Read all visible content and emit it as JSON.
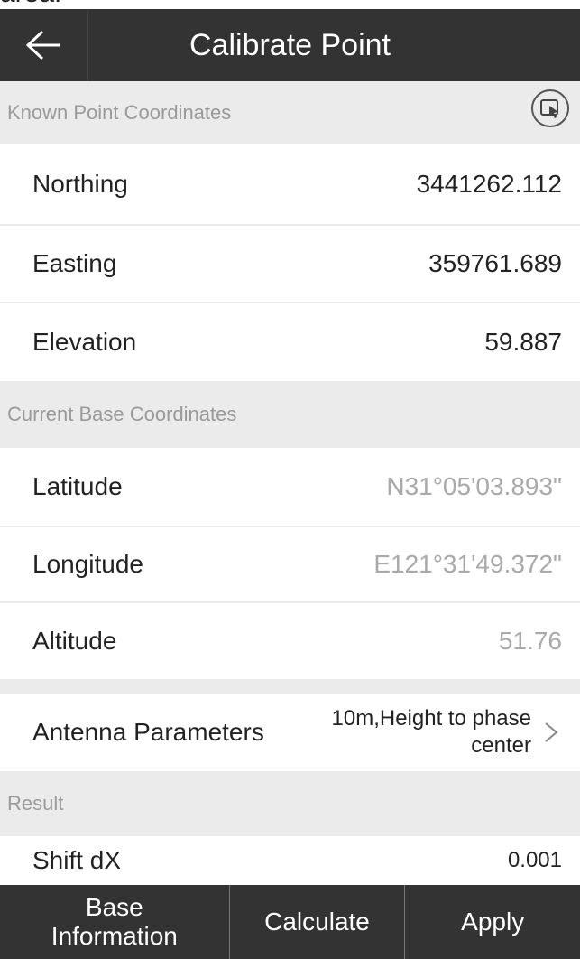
{
  "top_strip_text": "area.",
  "header": {
    "title": "Calibrate Point"
  },
  "known_section": {
    "title": "Known Point Coordinates"
  },
  "known_rows": [
    {
      "label": "Northing",
      "value": "3441262.112"
    },
    {
      "label": "Easting",
      "value": "359761.689"
    },
    {
      "label": "Elevation",
      "value": "59.887"
    }
  ],
  "base_section": {
    "title": "Current Base Coordinates"
  },
  "base_rows": [
    {
      "label": "Latitude",
      "value": "N31°05'03.893\""
    },
    {
      "label": "Longitude",
      "value": "E121°31'49.372\""
    },
    {
      "label": "Altitude",
      "value": "51.76"
    }
  ],
  "antenna": {
    "label": "Antenna Parameters",
    "value": "10m,Height to phase center"
  },
  "result_section": {
    "title": "Result"
  },
  "result_rows": [
    {
      "label": "Shift dX",
      "value": "0.001"
    }
  ],
  "bottom_bar": {
    "base_info": "Base Information",
    "calculate": "Calculate",
    "apply": "Apply"
  },
  "icons": {
    "back": "back-arrow-icon",
    "import": "import-point-icon",
    "chevron": "chevron-right-icon"
  }
}
